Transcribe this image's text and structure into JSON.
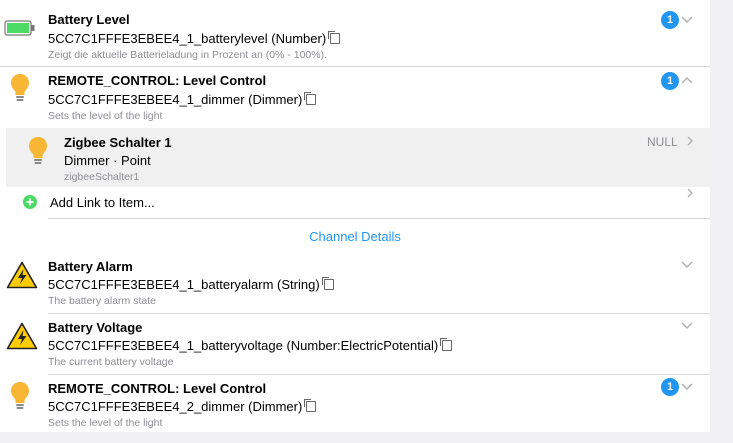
{
  "channels": [
    {
      "title": "Battery Level",
      "uid": "5CC7C1FFFE3EBEE4_1_batterylevel (Number)",
      "description": "Zeigt die aktuelle Batterieladung in Prozent an (0% - 100%).",
      "icon": "battery-icon",
      "badge": "1"
    },
    {
      "title": "REMOTE_CONTROL: Level Control",
      "uid": "5CC7C1FFFE3EBEE4_1_dimmer (Dimmer)",
      "description": "Sets the level of the light",
      "icon": "light-bulb-icon",
      "badge": "1"
    },
    {
      "title": "Battery Alarm",
      "uid": "5CC7C1FFFE3EBEE4_1_batteryalarm (String)",
      "description": "The battery alarm state",
      "icon": "warning-icon"
    },
    {
      "title": "Battery Voltage",
      "uid": "5CC7C1FFFE3EBEE4_1_batteryvoltage (Number:ElectricPotential)",
      "description": "The current battery voltage",
      "icon": "warning-icon"
    },
    {
      "title": "REMOTE_CONTROL: Level Control",
      "uid": "5CC7C1FFFE3EBEE4_2_dimmer (Dimmer)",
      "description": "Sets the level of the light",
      "icon": "light-bulb-icon",
      "badge": "1"
    }
  ],
  "linked_item": {
    "title": "Zigbee Schalter 1",
    "type": "Dimmer · Point",
    "name": "zigbeeSchalter1",
    "state": "NULL"
  },
  "add_link_label": "Add Link to Item...",
  "channel_details_label": "Channel Details",
  "colors": {
    "accent": "#2196f3",
    "battery": "#4cd964",
    "bulb": "#f9b534",
    "warning": "#ffcc00",
    "add": "#4cd964"
  }
}
